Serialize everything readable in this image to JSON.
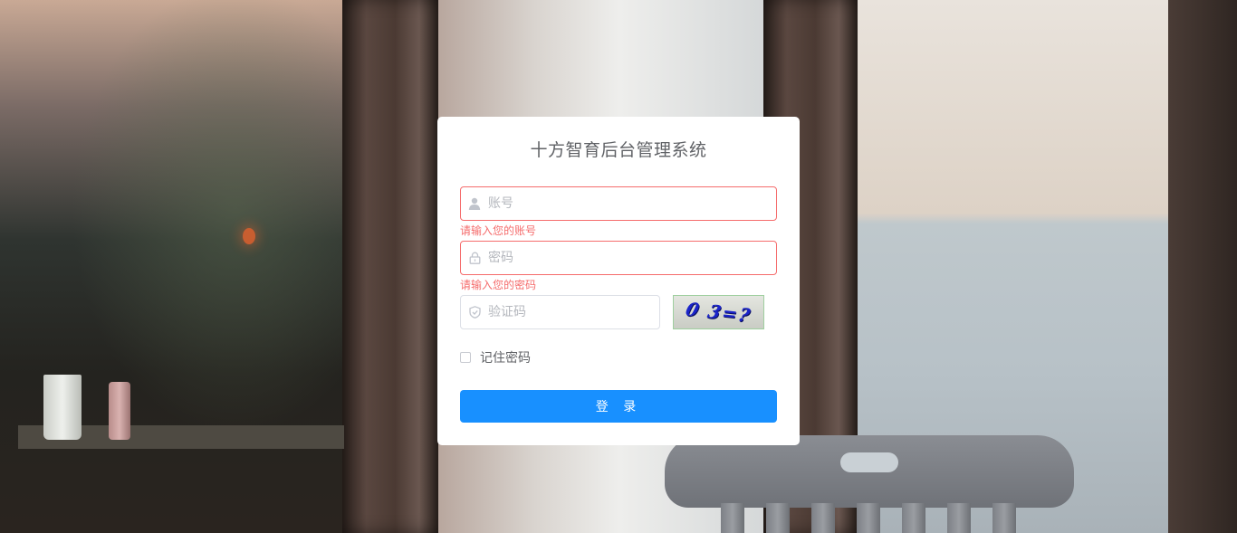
{
  "app": {
    "title": "十方智育后台管理系统"
  },
  "login": {
    "username": {
      "placeholder": "账号",
      "value": "",
      "error": "请输入您的账号",
      "icon": "user-icon"
    },
    "password": {
      "placeholder": "密码",
      "value": "",
      "error": "请输入您的密码",
      "icon": "lock-icon"
    },
    "code": {
      "placeholder": "验证码",
      "value": "",
      "icon": "shield-icon"
    },
    "captcha_text": "0 3=?",
    "remember": {
      "label": "记住密码",
      "checked": false
    },
    "submit_label": "登 录"
  },
  "colors": {
    "primary": "#1890ff",
    "error": "#f56c6c",
    "title": "#606266",
    "card": "#ffffff"
  }
}
